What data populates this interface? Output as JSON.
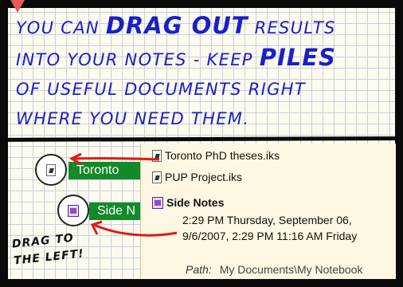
{
  "headline": {
    "line1_a": "You can ",
    "line1_big": "drag out",
    "line1_b": " results",
    "line2_a": "into your notes - keep ",
    "line2_big": "piles",
    "line3": "of useful documents right",
    "line4": "where you need them."
  },
  "results": [
    {
      "label": "Toronto PhD theses.iks",
      "icon": "search-file-icon"
    },
    {
      "label": "PUP Project.iks",
      "icon": "search-file-icon"
    },
    {
      "label": "Side Notes",
      "icon": "notes-file-icon"
    }
  ],
  "side_notes_detail": {
    "timestamp1": "2:29 PM Thursday, September 06,",
    "timestamp2": "9/6/2007, 2:29 PM 11:16 AM Friday",
    "path_label": "Path:",
    "path_value": "My Documents\\My Notebook"
  },
  "dragged_items": [
    {
      "label": "Toronto",
      "icon": "search-file-icon"
    },
    {
      "label": "Side N",
      "icon": "notes-file-icon"
    }
  ],
  "hand_note": {
    "line1": "drag to",
    "line2": "the left!"
  },
  "colors": {
    "headline": "#1a1fc8",
    "tag": "#128a29",
    "arrow": "#e11a1a"
  }
}
